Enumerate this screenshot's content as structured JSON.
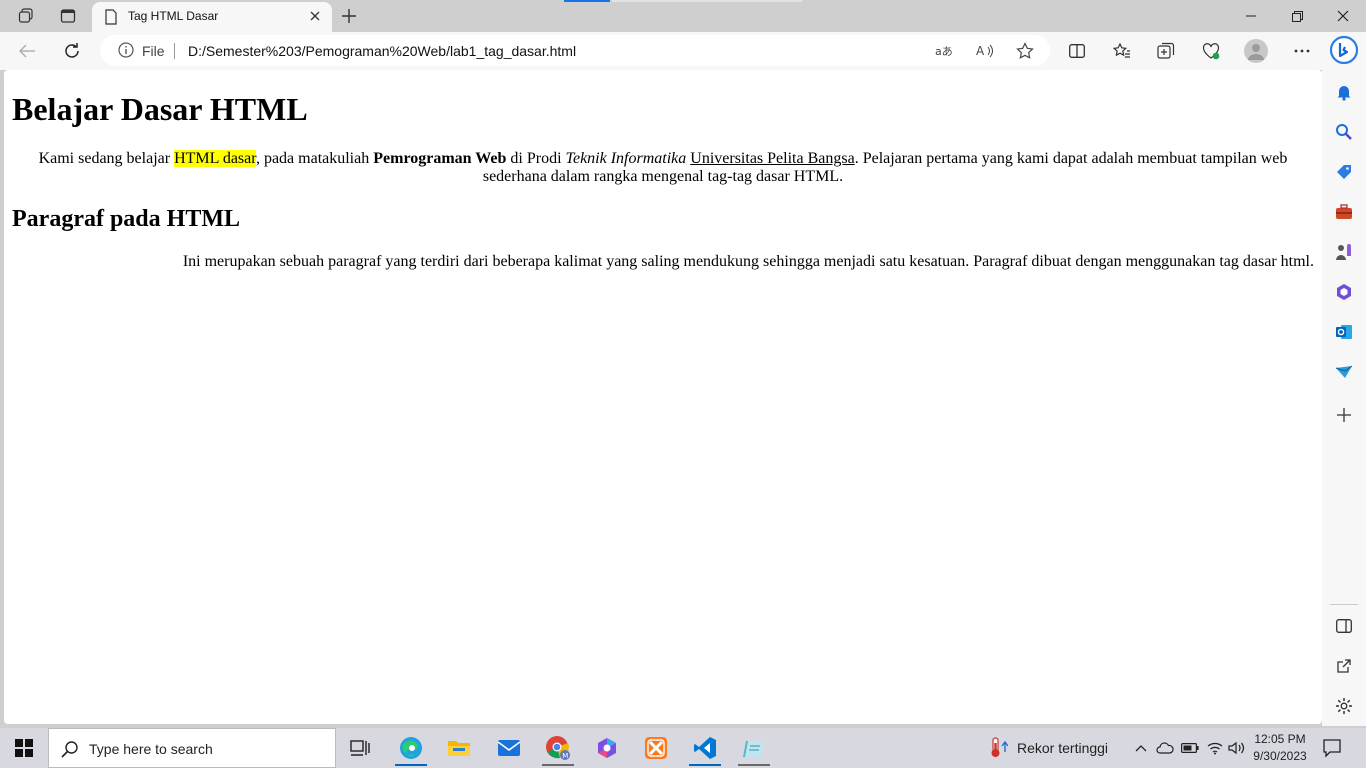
{
  "browser": {
    "tab_title": "Tag HTML Dasar",
    "address_scheme_label": "File",
    "url": "D:/Semester%203/Pemograman%20Web/lab1_tag_dasar.html"
  },
  "page": {
    "heading1": "Belajar Dasar HTML",
    "para1": {
      "t1": "Kami sedang belajar ",
      "highlight": "HTML dasar",
      "t2": ", pada matakuliah ",
      "bold": "Pemrograman Web",
      "t3": " di Prodi ",
      "italic": "Teknik Informatika",
      "t4": " ",
      "underline": "Universitas Pelita Bangsa",
      "t5": ". Pelajaran pertama yang kami dapat adalah membuat tampilan web sederhana dalam rangka mengenal tag-tag dasar HTML."
    },
    "heading2": "Paragraf pada HTML",
    "para2": "Ini merupakan sebuah paragraf yang terdiri dari beberapa kalimat yang saling mendukung sehingga menjadi satu kesatuan. Paragraf dibuat dengan menggunakan tag dasar html."
  },
  "taskbar": {
    "search_placeholder": "Type here to search",
    "weather_text": "Rekor tertinggi",
    "time": "12:05 PM",
    "date": "9/30/2023"
  },
  "colors": {
    "highlight": "#ffff00",
    "accent": "#0067c0"
  }
}
